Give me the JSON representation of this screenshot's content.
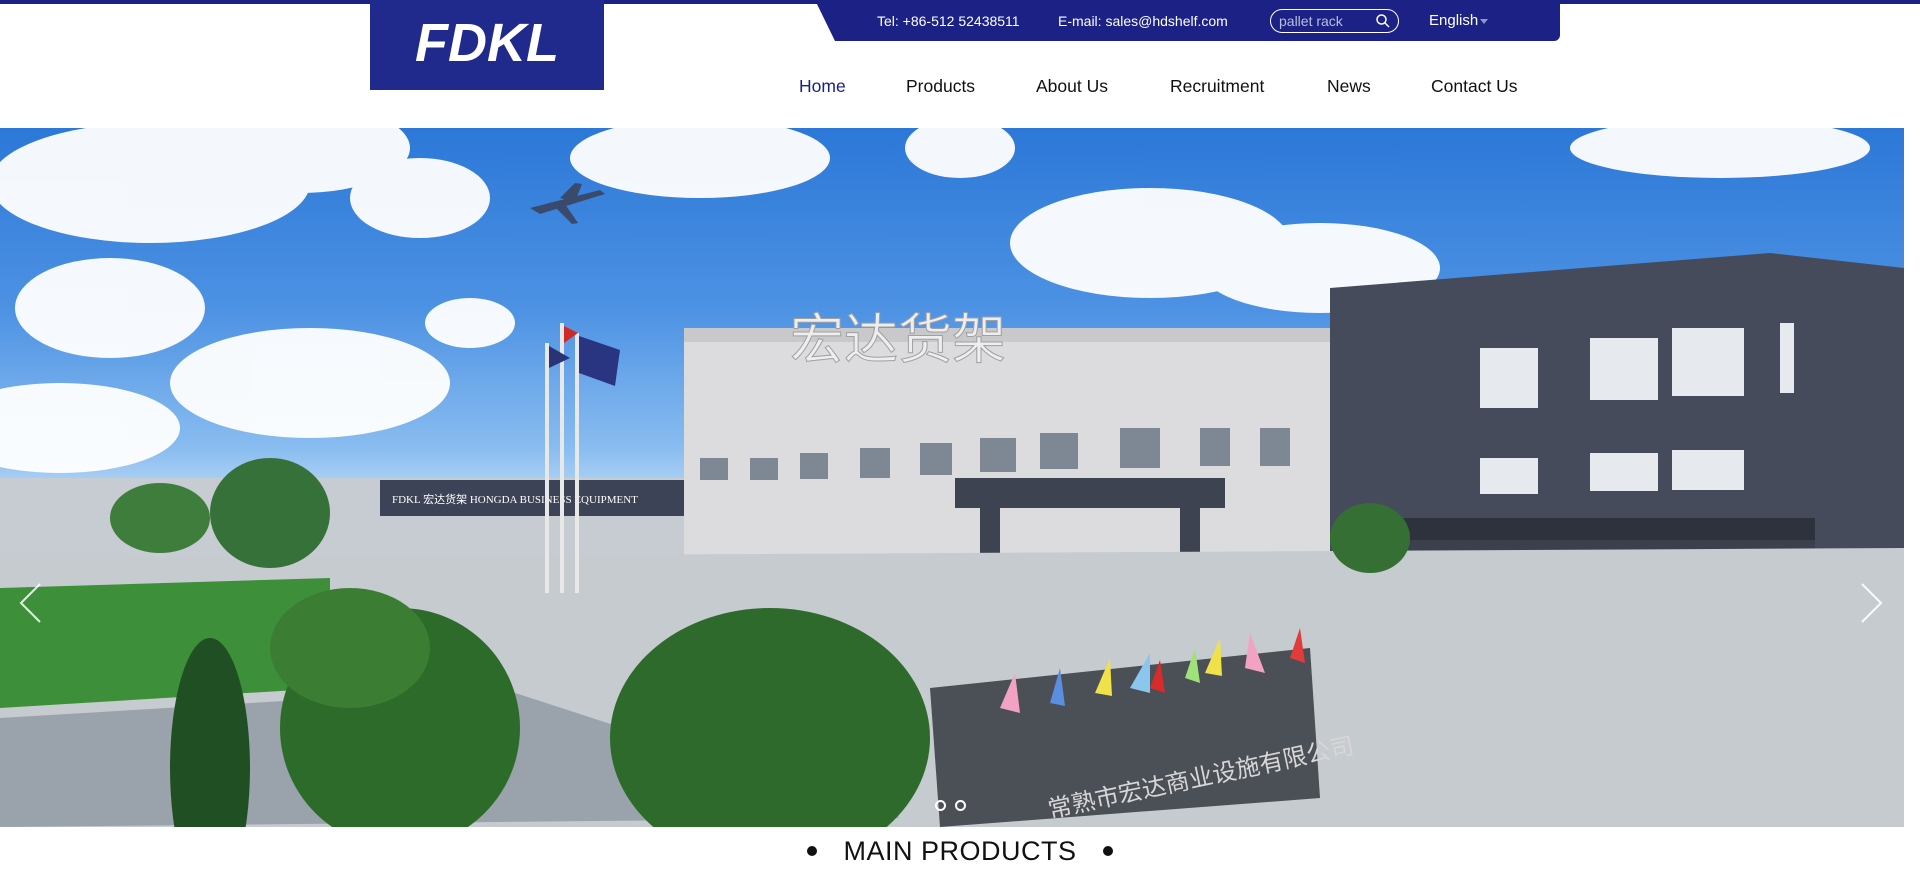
{
  "brand": {
    "logo_text": "FDKL",
    "color": "#1b2185"
  },
  "contact": {
    "tel": "Tel: +86-512 52438511",
    "email": "E-mail: sales@hdshelf.com"
  },
  "search": {
    "value": "",
    "placeholder": "pallet rack",
    "icon": "search-icon"
  },
  "language": {
    "selected": "English",
    "icon": "chevron-down-icon"
  },
  "nav": {
    "items": [
      {
        "label": "Home",
        "active": true
      },
      {
        "label": "Products",
        "active": false
      },
      {
        "label": "About Us",
        "active": false
      },
      {
        "label": "Recruitment",
        "active": false
      },
      {
        "label": "News",
        "active": false
      },
      {
        "label": "Contact Us",
        "active": false
      }
    ]
  },
  "hero": {
    "building_sign": "宏达货架",
    "gate_sign": "常熟市宏达商业设施有限公司",
    "side_sign": "FDKL 宏达货架 HONGDA BUSINESS EQUIPMENT",
    "prev_icon": "chevron-left-icon",
    "next_icon": "chevron-right-icon",
    "slides_count": 2
  },
  "section": {
    "title": "MAIN PRODUCTS"
  },
  "colors": {
    "accent": "#1b2185",
    "nav_text": "#111111"
  }
}
